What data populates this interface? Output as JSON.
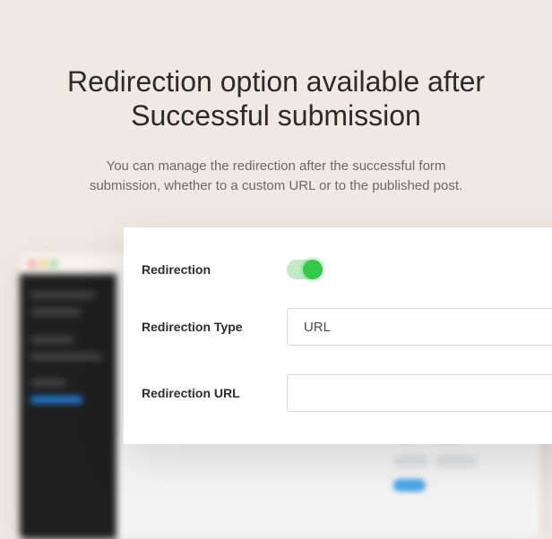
{
  "hero": {
    "title": "Redirection option available after Successful submission",
    "description": "You can manage the redirection after the successful form submission, whether to a custom URL or to the published post."
  },
  "panel": {
    "redirection": {
      "label": "Redirection",
      "enabled": true
    },
    "redirection_type": {
      "label": "Redirection Type",
      "value": "URL"
    },
    "redirection_url": {
      "label": "Redirection URL",
      "value": ""
    }
  }
}
